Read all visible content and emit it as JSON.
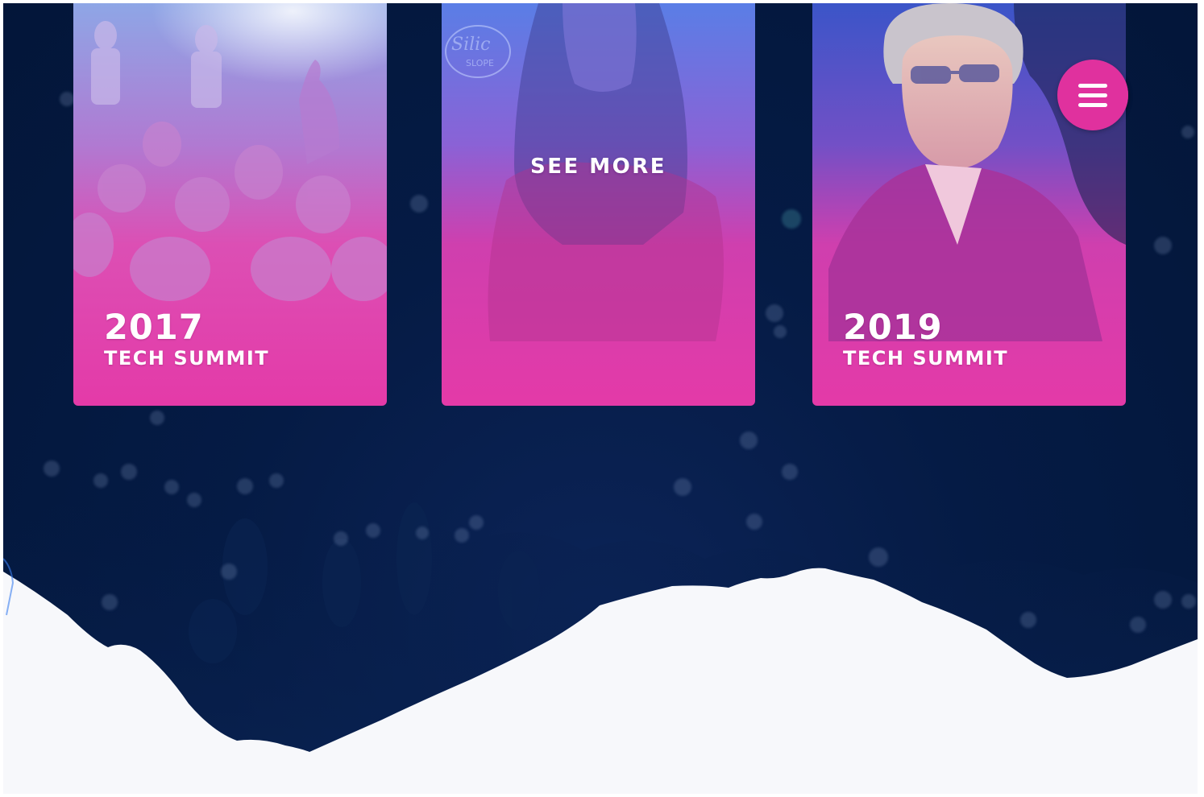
{
  "cards": [
    {
      "year": "2017",
      "subtitle": "TECH SUMMIT"
    },
    {
      "see_more_label": "SEE MORE"
    },
    {
      "year": "2019",
      "subtitle": "TECH SUMMIT"
    }
  ],
  "colors": {
    "background_navy": "#031639",
    "card_pink": "#e43aa8",
    "card_blue": "#5a7ee6",
    "menu_button": "#e0319e",
    "mountain_snow": "#f7f8fb"
  },
  "icons": {
    "menu": "hamburger-icon"
  }
}
